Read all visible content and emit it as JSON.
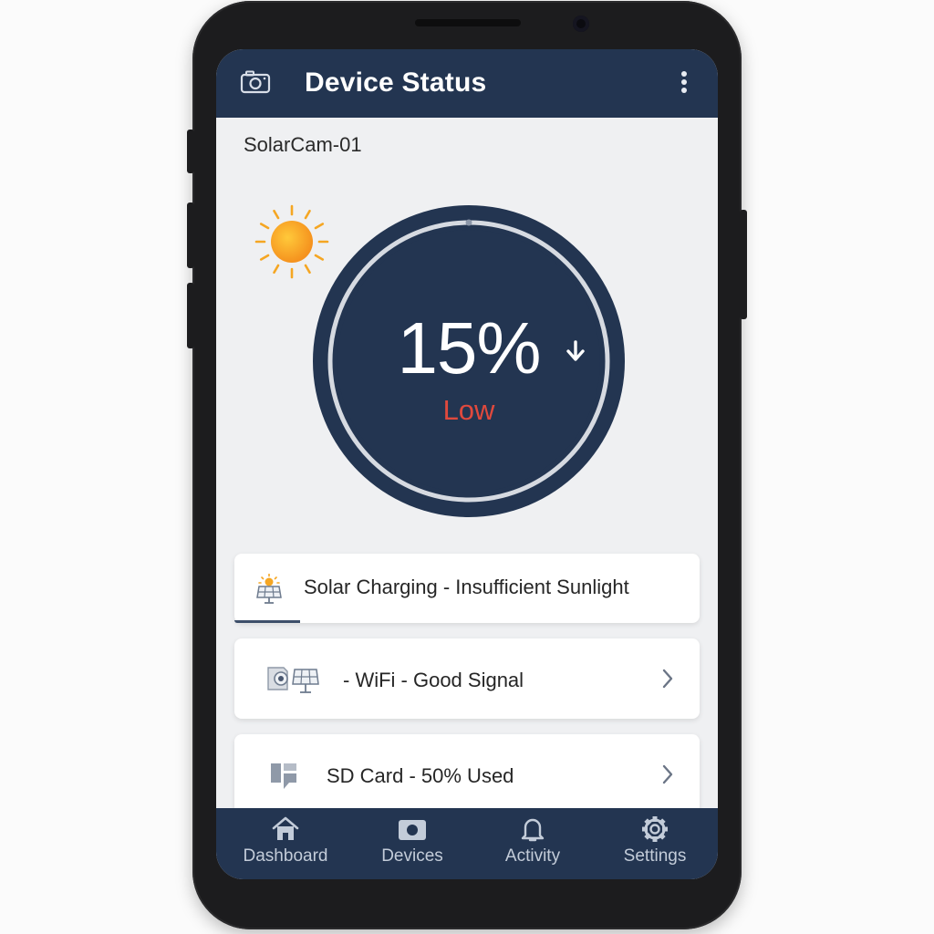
{
  "app": {
    "title": "Device Status",
    "device_name": "SolarCam-01"
  },
  "battery": {
    "percent_label": "15%",
    "level": 0.15,
    "status": "Low",
    "trend": "down-arrow-icon"
  },
  "cards": [
    {
      "icon": "solar-panel-sun-icon",
      "label": "Solar Charging - Insufficient Sunlight",
      "has_chevron": false
    },
    {
      "icon": "wifi-device-icon",
      "label": "- WiFi - Good Signal",
      "has_chevron": true
    },
    {
      "icon": "sd-card-icon",
      "label": "SD Card - 50% Used",
      "has_chevron": true
    }
  ],
  "nav": [
    {
      "icon": "home-icon",
      "label": "Dashboard"
    },
    {
      "icon": "camera-icon",
      "label": "Devices"
    },
    {
      "icon": "bell-icon",
      "label": "Activity"
    },
    {
      "icon": "gear-icon",
      "label": "Settings"
    }
  ],
  "colors": {
    "navy": "#233551",
    "accent_low": "#e0493d",
    "sun": "#f5a623",
    "screen_bg": "#eff0f2"
  }
}
